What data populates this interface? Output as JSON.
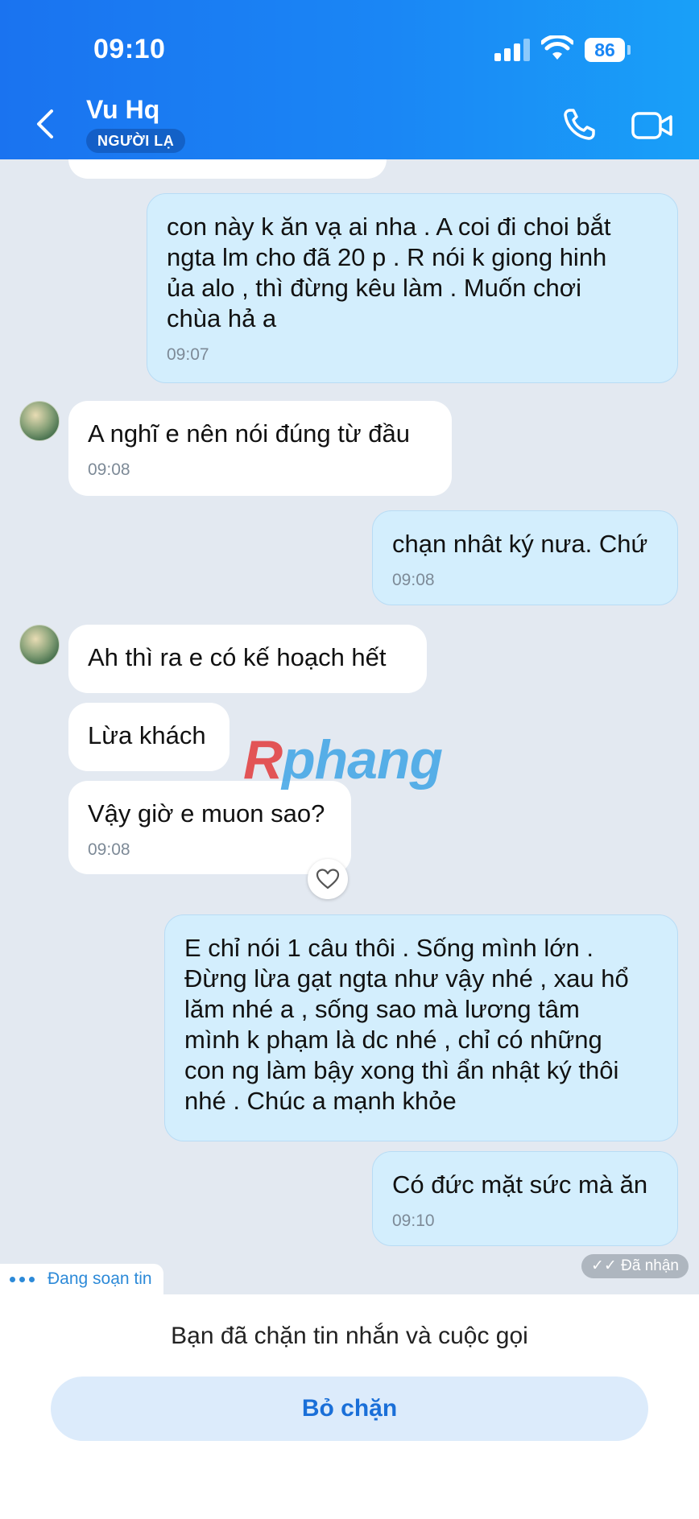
{
  "status_bar": {
    "time": "09:10",
    "battery": "86"
  },
  "header": {
    "contact_name": "Vu Hq",
    "contact_badge": "NGƯỜI LẠ"
  },
  "messages": [
    {
      "text": "con này k ăn vạ ai nha .   A coi đi choi bắt\nngta lm cho đã 20 p . R nói k giong hinh\nủa alo ,  thì đừng kêu làm . Muốn chơi\nchùa hả a",
      "time": "09:07"
    },
    {
      "text": "A nghĩ e nên nói đúng từ đầu",
      "time": "09:08"
    },
    {
      "text": "chạn nhât ký nưa. Chứ",
      "time": "09:08"
    },
    {
      "text": "Ah thì ra e có kế hoạch hết"
    },
    {
      "text": "Lừa khách"
    },
    {
      "text": "Vậy giờ e muon sao?",
      "time": "09:08"
    },
    {
      "text": "E chỉ nói 1 câu thôi . Sống mình lớn .\nĐừng lừa gạt ngta như vậy nhé , xau hổ\nlăm nhé a ,   sống sao mà lương tâm\nmình k phạm là dc nhé , chỉ có những\ncon ng làm bậy xong thì ẩn nhật ký thôi\nnhé . Chúc a mạnh khỏe"
    },
    {
      "text": "Có đức mặt sức mà ăn",
      "time": "09:10"
    }
  ],
  "watermark": {
    "first": "R",
    "rest": "phang"
  },
  "received_label": "Đã nhận",
  "typing_label": "Đang soạn tin",
  "footer": {
    "blocked_text": "Bạn đã chặn tin nhắn và cuộc gọi",
    "unblock_label": "Bỏ chặn"
  },
  "colors": {
    "header_blue": "#1a86f5",
    "outgoing_bubble": "#d3eefd",
    "incoming_bubble": "#ffffff",
    "background": "#e3e9f1"
  }
}
